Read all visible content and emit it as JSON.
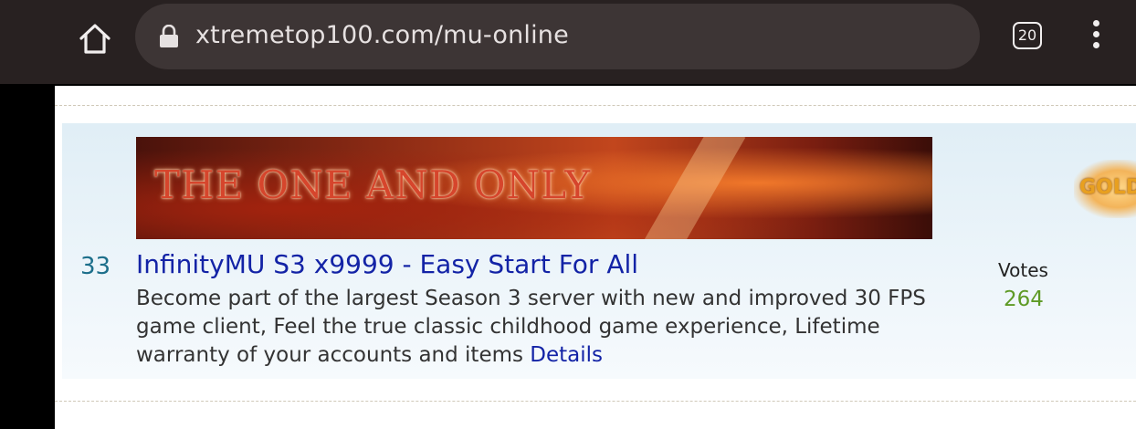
{
  "browser": {
    "url": "xtremetop100.com/mu-online",
    "tab_count": "20",
    "icons": {
      "home": "home-icon",
      "lock": "lock-icon",
      "menu": "more-vert-icon"
    }
  },
  "listing": {
    "banner_text": "THE ONE AND ONLY",
    "rank": "33",
    "title": "InfinityMU S3 x9999 - Easy Start For All",
    "description": "Become part of the largest Season 3 server with new and improved 30 FPS game client, Feel the true classic childhood game experience, Lifetime warranty of your accounts and items",
    "details_link": "Details",
    "votes_label": "Votes",
    "votes_count": "264",
    "side_banner_text": "GOLD"
  },
  "colors": {
    "title_link": "#1323a6",
    "rank": "#1d6f8b",
    "votes_count": "#5e9a25"
  }
}
